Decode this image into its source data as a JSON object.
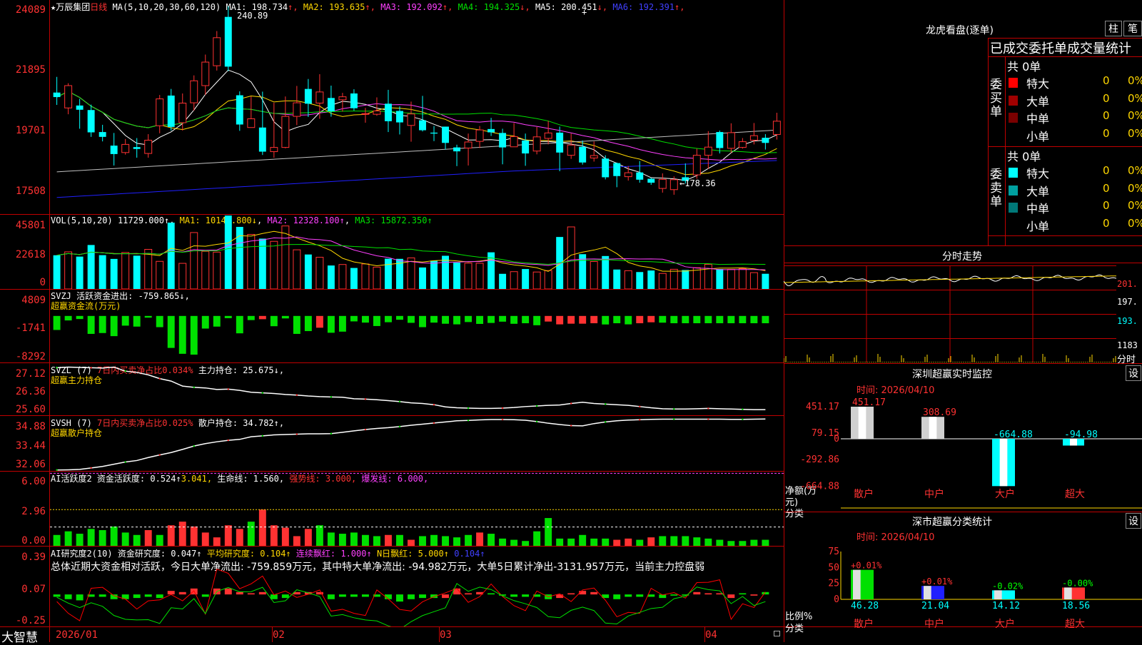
{
  "stock": {
    "star": "★",
    "name": "万辰集团",
    "period": "日线",
    "brand": "大智慧"
  },
  "kline": {
    "ma_params": "MA(5,10,20,30,60,120)",
    "ma_values": [
      {
        "label": "MA1: 198.734",
        "arrow": "↑",
        "color": "#ffffff"
      },
      {
        "label": "MA2: 193.635",
        "arrow": "↑",
        "color": "#ffd700"
      },
      {
        "label": "MA3: 192.092",
        "arrow": "↑",
        "color": "#ff40ff"
      },
      {
        "label": "MA4: 194.325",
        "arrow": "↓",
        "color": "#00e000"
      },
      {
        "label": "MA5: 200.451",
        "arrow": "↓",
        "color": "#ffffff"
      },
      {
        "label": "MA6: 192.391",
        "arrow": "↑",
        "color": "#4040ff"
      }
    ],
    "yticks": [
      "24089",
      "21895",
      "19701",
      "17508"
    ],
    "ylim": [
      17200,
      24300
    ],
    "high_label": "240.89",
    "low_label": "←178.36",
    "candles": [
      {
        "o": 212.3,
        "c": 210.8,
        "h": 217.5,
        "l": 208.2
      },
      {
        "o": 207.2,
        "c": 214.6,
        "h": 215.4,
        "l": 205.1
      },
      {
        "o": 208.0,
        "c": 206.6,
        "h": 210.2,
        "l": 200.3
      },
      {
        "o": 206.5,
        "c": 199.1,
        "h": 208.3,
        "l": 197.6
      },
      {
        "o": 199.2,
        "c": 197.6,
        "h": 201.6,
        "l": 196.1
      },
      {
        "o": 194.7,
        "c": 191.9,
        "h": 198.9,
        "l": 188.1
      },
      {
        "o": 192.4,
        "c": 195.1,
        "h": 196.9,
        "l": 191.7
      },
      {
        "o": 194.2,
        "c": 193.6,
        "h": 197.2,
        "l": 190.7
      },
      {
        "o": 192.1,
        "c": 196.5,
        "h": 198.5,
        "l": 190.7
      },
      {
        "o": 201.3,
        "c": 210.2,
        "h": 211.5,
        "l": 198.8
      },
      {
        "o": 211.3,
        "c": 200.9,
        "h": 213.5,
        "l": 199.7
      },
      {
        "o": 202.3,
        "c": 208.8,
        "h": 212.0,
        "l": 199.7
      },
      {
        "o": 208.9,
        "c": 216.2,
        "h": 218.0,
        "l": 206.3
      },
      {
        "o": 214.6,
        "c": 222.4,
        "h": 224.9,
        "l": 211.5
      },
      {
        "o": 221.2,
        "c": 230.5,
        "h": 232.7,
        "l": 219.6
      },
      {
        "o": 237.4,
        "c": 220.9,
        "h": 240.9,
        "l": 219.4
      },
      {
        "o": 211.4,
        "c": 201.7,
        "h": 212.7,
        "l": 199.6
      },
      {
        "o": 200.7,
        "c": 203.6,
        "h": 211.0,
        "l": 200.7
      },
      {
        "o": 200.7,
        "c": 192.7,
        "h": 212.6,
        "l": 191.6
      },
      {
        "o": 192.7,
        "c": 194.1,
        "h": 208.9,
        "l": 190.7
      },
      {
        "o": 194.1,
        "c": 204.4,
        "h": 211.0,
        "l": 193.8
      },
      {
        "o": 204.4,
        "c": 208.9,
        "h": 214.5,
        "l": 201.5
      },
      {
        "o": 213.5,
        "c": 208.6,
        "h": 216.8,
        "l": 204.2
      },
      {
        "o": 208.8,
        "c": 212.5,
        "h": 218.4,
        "l": 203.6
      },
      {
        "o": 210.5,
        "c": 206.1,
        "h": 214.6,
        "l": 204.3
      },
      {
        "o": 209.9,
        "c": 210.9,
        "h": 212.2,
        "l": 206.0
      },
      {
        "o": 212.0,
        "c": 207.1,
        "h": 213.4,
        "l": 206.3
      },
      {
        "o": 205.2,
        "c": 205.3,
        "h": 207.2,
        "l": 202.3
      },
      {
        "o": 205.1,
        "c": 206.2,
        "h": 210.7,
        "l": 204.6
      },
      {
        "o": 208.6,
        "c": 202.8,
        "h": 213.2,
        "l": 199.2
      },
      {
        "o": 206.2,
        "c": 202.4,
        "h": 207.7,
        "l": 198.4
      },
      {
        "o": 201.4,
        "c": 205.2,
        "h": 209.3,
        "l": 196.0
      },
      {
        "o": 203.1,
        "c": 199.8,
        "h": 211.2,
        "l": 199.4
      },
      {
        "o": 199.0,
        "c": 198.7,
        "h": 201.2,
        "l": 196.2
      },
      {
        "o": 201.0,
        "c": 195.6,
        "h": 201.0,
        "l": 193.4
      },
      {
        "o": 194.1,
        "c": 192.8,
        "h": 195.0,
        "l": 187.9
      },
      {
        "o": 193.9,
        "c": 195.9,
        "h": 198.7,
        "l": 188.1
      },
      {
        "o": 196.1,
        "c": 199.9,
        "h": 201.2,
        "l": 193.9
      },
      {
        "o": 200.2,
        "c": 199.1,
        "h": 203.9,
        "l": 197.9
      },
      {
        "o": 198.9,
        "c": 194.1,
        "h": 200.3,
        "l": 188.5
      },
      {
        "o": 194.3,
        "c": 197.7,
        "h": 202.2,
        "l": 194.3
      },
      {
        "o": 196.4,
        "c": 192.1,
        "h": 198.7,
        "l": 188.0
      },
      {
        "o": 192.9,
        "c": 197.6,
        "h": 200.9,
        "l": 191.8
      },
      {
        "o": 197.1,
        "c": 198.9,
        "h": 202.9,
        "l": 195.1
      },
      {
        "o": 199.0,
        "c": 192.4,
        "h": 201.0,
        "l": 186.2
      },
      {
        "o": 191.5,
        "c": 194.9,
        "h": 198.7,
        "l": 190.3
      },
      {
        "o": 194.3,
        "c": 189.1,
        "h": 196.4,
        "l": 188.4
      },
      {
        "o": 190.6,
        "c": 191.4,
        "h": 196.1,
        "l": 189.4
      },
      {
        "o": 190.4,
        "c": 184.2,
        "h": 191.5,
        "l": 183.5
      },
      {
        "o": 188.9,
        "c": 184.6,
        "h": 189.1,
        "l": 180.9
      },
      {
        "o": 184.4,
        "c": 185.7,
        "h": 187.9,
        "l": 183.1
      },
      {
        "o": 185.8,
        "c": 183.4,
        "h": 189.6,
        "l": 182.4
      },
      {
        "o": 183.7,
        "c": 182.4,
        "h": 184.0,
        "l": 181.7
      },
      {
        "o": 180.5,
        "c": 183.5,
        "h": 185.5,
        "l": 179.1
      },
      {
        "o": 180.1,
        "c": 183.4,
        "h": 184.5,
        "l": 178.4
      },
      {
        "o": 184.2,
        "c": 183.0,
        "h": 188.8,
        "l": 182.1
      },
      {
        "o": 185.0,
        "c": 191.5,
        "h": 193.7,
        "l": 183.7
      },
      {
        "o": 191.5,
        "c": 194.2,
        "h": 199.5,
        "l": 187.0
      },
      {
        "o": 199.2,
        "c": 193.9,
        "h": 199.7,
        "l": 192.1
      },
      {
        "o": 193.8,
        "c": 199.0,
        "h": 202.1,
        "l": 192.3
      },
      {
        "o": 194.1,
        "c": 196.0,
        "h": 197.2,
        "l": 193.7
      },
      {
        "o": 196.5,
        "c": 198.0,
        "h": 202.2,
        "l": 195.1
      },
      {
        "o": 197.3,
        "c": 195.6,
        "h": 198.5,
        "l": 193.4
      },
      {
        "o": 198.4,
        "c": 202.8,
        "h": 205.6,
        "l": 196.7
      }
    ]
  },
  "vol": {
    "header": "VOL(5,10,20)",
    "value": "11729.000↑",
    "ma1": "MA1: 10144.800↓",
    "ma2": "MA2: 12328.100↑",
    "ma3": "MA3: 15872.350↑",
    "yticks": [
      "45801",
      "22618",
      "0"
    ],
    "ylim": [
      0,
      46000
    ],
    "values": [
      20700,
      22790,
      19870,
      27000,
      20770,
      18460,
      22380,
      20450,
      24320,
      16960,
      40740,
      15740,
      34640,
      23100,
      22630,
      45070,
      38120,
      33520,
      30900,
      29250,
      38700,
      24050,
      21170,
      19480,
      14410,
      15020,
      12900,
      15360,
      13420,
      18610,
      18490,
      19090,
      13200,
      17370,
      20380,
      16160,
      15830,
      15780,
      22500,
      9300,
      10640,
      12240,
      10420,
      11310,
      31920,
      38110,
      21350,
      16860,
      20230,
      11930,
      11200,
      10400,
      11340,
      9540,
      12100,
      11640,
      13070,
      15120,
      12250,
      12060,
      12460,
      10040,
      9330
    ]
  },
  "svzj": {
    "header": "SVZJ 活跃资金进出: -759.865↓,",
    "sub": "超赢资金流(万元)",
    "yticks": [
      "4809",
      "-1741",
      "-8292"
    ],
    "ylim": [
      -8292,
      4809
    ],
    "values": [
      -2500,
      -800,
      -550,
      -3200,
      -3050,
      -3600,
      -1730,
      -1900,
      -300,
      -2000,
      -5700,
      -6750,
      -6900,
      -2250,
      -1900,
      -390,
      -3100,
      -740,
      -580,
      -1830,
      -440,
      -3200,
      -2700,
      -2100,
      -3000,
      -2800,
      -970,
      -1190,
      -1800,
      -1120,
      -680,
      -1230,
      -2000,
      -1190,
      -1390,
      -1500,
      -1090,
      -1420,
      -1250,
      -1020,
      -1400,
      -1300,
      -1660,
      -1000,
      -1500,
      -1380,
      -1380,
      -1300,
      -1520,
      -1300,
      -1500,
      -1300,
      -1130,
      -1200,
      -1300,
      -1300,
      -1300,
      -1300,
      -1300,
      -1300,
      -1300,
      -1300,
      -1300
    ],
    "colors": "ggggggggggggggggggrggggrgggggggggggggggggggrrrrrgggrrgggggggggggggggg"
  },
  "svzl": {
    "header_a": "SVZL (7)",
    "header_b": "7日内买卖净占比0.034%",
    "header_c": "主力持仓: 25.675↓,",
    "sub": "超赢主力持仓",
    "yticks": [
      "27.12",
      "26.36",
      "25.60"
    ],
    "ylim": [
      25.5,
      27.2
    ],
    "values": [
      27.03,
      27.05,
      27.04,
      27.03,
      27.02,
      27.05,
      26.92,
      26.88,
      26.8,
      26.68,
      26.6,
      26.44,
      26.4,
      26.38,
      26.33,
      26.34,
      26.3,
      26.24,
      26.22,
      26.2,
      26.17,
      26.15,
      26.12,
      26.1,
      26.09,
      26.08,
      26.03,
      26.02,
      26.0,
      25.97,
      25.94,
      25.9,
      25.88,
      25.84,
      25.77,
      25.74,
      25.73,
      25.72,
      25.72,
      25.73,
      25.75,
      25.78,
      25.8,
      25.82,
      25.83,
      25.88,
      25.92,
      25.88,
      25.86,
      25.84,
      25.82,
      25.78,
      25.74,
      25.71,
      25.7,
      25.7,
      25.71,
      25.72,
      25.71,
      25.7,
      25.69,
      25.68,
      25.68
    ]
  },
  "svsh": {
    "header_a": "SVSH (7)",
    "header_b": "7日内买卖净占比0.025%",
    "header_c": "散户持仓: 34.782↑,",
    "sub": "超赢散户持仓",
    "yticks": [
      "34.88",
      "33.44",
      "32.06"
    ],
    "ylim": [
      32.0,
      35.0
    ],
    "values": [
      32.05,
      32.06,
      32.08,
      32.16,
      32.24,
      32.36,
      32.48,
      32.56,
      32.72,
      32.86,
      32.99,
      33.16,
      33.34,
      33.47,
      33.57,
      33.65,
      33.7,
      33.84,
      33.89,
      33.94,
      33.96,
      33.98,
      34.0,
      34.0,
      34.01,
      34.08,
      34.16,
      34.23,
      34.29,
      34.33,
      34.39,
      34.46,
      34.52,
      34.58,
      34.64,
      34.7,
      34.72,
      34.75,
      34.77,
      34.77,
      34.76,
      34.73,
      34.66,
      34.57,
      34.5,
      34.44,
      34.43,
      34.55,
      34.64,
      34.7,
      34.74,
      34.76,
      34.78,
      34.79,
      34.79,
      34.79,
      34.79,
      34.79,
      34.79,
      34.78,
      34.78,
      34.79,
      34.8
    ]
  },
  "ai1": {
    "header_a": "AI活跃度2",
    "header_b": "资金活跃度: 0.524↑",
    "header_c": "3.041,",
    "header_d": "生命线: 1.560,",
    "header_e": "强势线: 3.000,",
    "header_f": "爆发线: 6.000,",
    "yticks": [
      "6.00",
      "2.96",
      "0.00"
    ],
    "ylim": [
      0,
      6.2
    ],
    "values": [
      0.9,
      1.2,
      1.0,
      1.4,
      1.3,
      1.6,
      1.1,
      0.9,
      1.3,
      0.9,
      1.7,
      2.0,
      1.6,
      1.1,
      0.7,
      1.7,
      1.4,
      2.0,
      3.0,
      1.7,
      1.5,
      0.8,
      1.4,
      1.7,
      1.1,
      1.0,
      1.1,
      0.9,
      0.8,
      0.9,
      0.9,
      0.5,
      0.8,
      0.9,
      0.8,
      0.7,
      0.9,
      1.1,
      1.0,
      0.6,
      0.5,
      0.4,
      1.2,
      2.3,
      0.6,
      0.6,
      0.9,
      0.6,
      0.6,
      0.5,
      0.6,
      0.5,
      0.7,
      0.8,
      0.8,
      0.8,
      0.7,
      0.6,
      0.5,
      0.4,
      0.4,
      0.5,
      0.5
    ],
    "colors": "ggggggggrgrrrrrrrgrrrrrggggggrgrgggggrgggggggggggrrgrgggggggggggggggrr"
  },
  "ai2": {
    "header_a": "AI研究度2(10)",
    "header_b": "资金研究度: 0.047↑",
    "header_c": "平均研究度: 0.104↑",
    "header_d": "连续飘红: 1.000↑",
    "header_e": "N日飘红: 5.000↑",
    "header_f": "0.104↑",
    "text": "总体近期大资金相对活跃，今日大单净流出: -759.859万元，其中特大单净流出: -94.982万元，大单5日累计净出-3131.957万元，当前主力控盘弱",
    "yticks": [
      "0.39",
      "0.07",
      "-0.25"
    ],
    "ylim": [
      -0.27,
      0.41
    ],
    "values": [
      -0.02,
      -0.04,
      -0.05,
      -0.02,
      -0.02,
      -0.04,
      -0.04,
      -0.03,
      -0.02,
      -0.03,
      0.03,
      0.02,
      0.05,
      -0.02,
      0.05,
      0.05,
      0.02,
      0.01,
      0.02,
      -0.04,
      -0.03,
      0.02,
      0.02,
      0.02,
      -0.04,
      -0.02,
      -0.02,
      -0.02,
      -0.02,
      -0.04,
      -0.06,
      -0.04,
      -0.03,
      -0.03,
      -0.03,
      0.05,
      0.01,
      0.02,
      0.01,
      -0.01,
      -0.02,
      -0.02,
      -0.02,
      -0.04,
      -0.03,
      0.01,
      0.03,
      0.02,
      -0.03,
      -0.04,
      -0.02,
      -0.02,
      -0.02,
      -0.03,
      -0.01,
      -0.01,
      0.02,
      0.01,
      0.01,
      -0.03,
      0.01,
      -0.01,
      0.02
    ],
    "colors": "ggggggggggrrrgrrrrrggrrrggggggggggrrrrggggggrrrrggggggggrrrrgrgrr"
  },
  "xaxis": {
    "labels": [
      "2026/01",
      "02",
      "03",
      "04"
    ]
  },
  "right": {
    "lhb_title": "龙虎看盘(逐单)",
    "btn1": "柱",
    "btn2": "笔",
    "stat_title": "已成交委托单成交量统计",
    "buy_label": "委买单",
    "sell_label": "委卖单",
    "buy_total": "共 0单",
    "sell_total": "共 0单",
    "buy_rows": [
      {
        "name": "特大",
        "n": "0",
        "pct": "0%",
        "color": "#ff0000"
      },
      {
        "name": "大单",
        "n": "0",
        "pct": "0%",
        "color": "#a00000"
      },
      {
        "name": "中单",
        "n": "0",
        "pct": "0%",
        "color": "#7a0000"
      },
      {
        "name": "小单",
        "n": "0",
        "pct": "0%",
        "color": "#000"
      }
    ],
    "sell_rows": [
      {
        "name": "特大",
        "n": "0",
        "pct": "0%",
        "color": "#00ffff"
      },
      {
        "name": "大单",
        "n": "0",
        "pct": "0%",
        "color": "#00a0a0"
      },
      {
        "name": "中单",
        "n": "0",
        "pct": "0%",
        "color": "#007878"
      },
      {
        "name": "小单",
        "n": "0",
        "pct": "0%",
        "color": "#000"
      }
    ],
    "fs_title": "分时走势",
    "fs_yticks": [
      "201.",
      "197.",
      "193.",
      "1183",
      "分时"
    ],
    "monitor_title": "深圳超赢实时监控",
    "monitor_btn": "设",
    "monitor_time": "时间: 2026/04/10",
    "monitor_yticks": [
      "451.17",
      "79.15",
      "0",
      "-292.86",
      "-664.88"
    ],
    "monitor_ylabel": "净额(万元)",
    "monitor_xlabel": "分类",
    "monitor_bars": [
      {
        "cat": "散户",
        "value": 451.17,
        "label": "451.17"
      },
      {
        "cat": "中户",
        "value": 308.69,
        "label": "308.69"
      },
      {
        "cat": "大户",
        "value": -664.88,
        "label": "-664.88"
      },
      {
        "cat": "超大",
        "value": -94.98,
        "label": "-94.98"
      }
    ],
    "class_title": "深市超赢分类统计",
    "class_btn": "设",
    "class_time": "时间: 2026/04/10",
    "class_yticks": [
      "75",
      "50",
      "25",
      "0"
    ],
    "class_ylabel": "比例%",
    "class_xlabel": "分类",
    "class_bars": [
      {
        "cat": "散户",
        "value": 46.28,
        "top": "+0.01%",
        "bottom": "46.28"
      },
      {
        "cat": "中户",
        "value": 21.04,
        "top": "+0.01%",
        "bottom": "21.04"
      },
      {
        "cat": "大户",
        "value": 14.12,
        "top": "-0.02%",
        "bottom": "14.12"
      },
      {
        "cat": "超大",
        "value": 18.56,
        "top": "-0.00%",
        "bottom": "18.56"
      }
    ]
  },
  "colors": {
    "grid": "#c00000",
    "up": "#ff3232",
    "down": "#00ffff",
    "green": "#00e000",
    "yellow": "#ffd700",
    "magenta": "#ff40ff"
  }
}
